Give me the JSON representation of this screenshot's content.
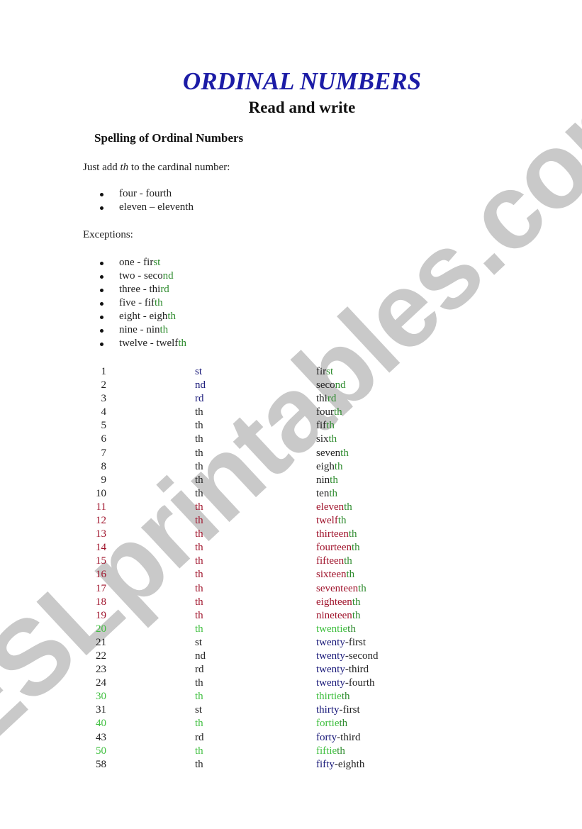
{
  "watermark": "ESLprintables.com",
  "header": {
    "title": "ORDINAL NUMBERS",
    "subtitle": "Read and write"
  },
  "section": {
    "heading": "Spelling of Ordinal Numbers",
    "intro_pre": "Just add ",
    "intro_em": "th",
    "intro_post": " to the cardinal number:",
    "rule_examples": [
      {
        "text": "four - fourth"
      },
      {
        "text": "eleven – eleventh"
      }
    ],
    "exceptions_label": "Exceptions:",
    "exceptions": [
      {
        "base": "one - fir",
        "ending": "st"
      },
      {
        "base": "two - seco",
        "ending": "nd"
      },
      {
        "base": "three - thi",
        "ending": "rd"
      },
      {
        "base": "five - fif",
        "ending": "th"
      },
      {
        "base": "eight - eigh",
        "ending": "th"
      },
      {
        "base": "nine - nin",
        "ending": "th"
      },
      {
        "base": "twelve - twelf",
        "ending": "th"
      }
    ]
  },
  "colors": {
    "title": "#1c1ca6",
    "navy": "#1a1a7a",
    "red": "#a0142c",
    "light_green": "#3fbf3f",
    "dark_green": "#2e8b2e",
    "dark": "#222222",
    "watermark": "#c9c9c9"
  },
  "table": {
    "rows": [
      {
        "num": "1",
        "suffix": "st",
        "stem": "fir",
        "ending": "st",
        "numColor": "dark",
        "sufColor": "navy",
        "stemColor": "dark",
        "endColor": "dgreen"
      },
      {
        "num": "2",
        "suffix": "nd",
        "stem": "seco",
        "ending": "nd",
        "numColor": "dark",
        "sufColor": "navy",
        "stemColor": "dark",
        "endColor": "dgreen"
      },
      {
        "num": "3",
        "suffix": "rd",
        "stem": "thi",
        "ending": "rd",
        "numColor": "dark",
        "sufColor": "navy",
        "stemColor": "dark",
        "endColor": "dgreen"
      },
      {
        "num": "4",
        "suffix": "th",
        "stem": "four",
        "ending": "th",
        "numColor": "dark",
        "sufColor": "dark",
        "stemColor": "dark",
        "endColor": "dgreen"
      },
      {
        "num": "5",
        "suffix": "th",
        "stem": "fif",
        "ending": "th",
        "numColor": "dark",
        "sufColor": "dark",
        "stemColor": "dark",
        "endColor": "dgreen"
      },
      {
        "num": "6",
        "suffix": "th",
        "stem": "six",
        "ending": "th",
        "numColor": "dark",
        "sufColor": "dark",
        "stemColor": "dark",
        "endColor": "dgreen"
      },
      {
        "num": "7",
        "suffix": "th",
        "stem": "seven",
        "ending": "th",
        "numColor": "dark",
        "sufColor": "dark",
        "stemColor": "dark",
        "endColor": "dgreen"
      },
      {
        "num": "8",
        "suffix": "th",
        "stem": "eigh",
        "ending": "th",
        "numColor": "dark",
        "sufColor": "dark",
        "stemColor": "dark",
        "endColor": "dgreen"
      },
      {
        "num": "9",
        "suffix": "th",
        "stem": "nin",
        "ending": "th",
        "numColor": "dark",
        "sufColor": "dark",
        "stemColor": "dark",
        "endColor": "dgreen"
      },
      {
        "num": "10",
        "suffix": "th",
        "stem": "ten",
        "ending": "th",
        "numColor": "dark",
        "sufColor": "dark",
        "stemColor": "dark",
        "endColor": "dgreen"
      },
      {
        "num": "11",
        "suffix": "th",
        "stem": "eleven",
        "ending": "th",
        "numColor": "red",
        "sufColor": "red",
        "stemColor": "red",
        "endColor": "dgreen"
      },
      {
        "num": "12",
        "suffix": "th",
        "stem": "twelf",
        "ending": "th",
        "numColor": "red",
        "sufColor": "red",
        "stemColor": "red",
        "endColor": "dgreen"
      },
      {
        "num": "13",
        "suffix": "th",
        "stem": "thirteen",
        "ending": "th",
        "numColor": "red",
        "sufColor": "red",
        "stemColor": "red",
        "endColor": "dgreen"
      },
      {
        "num": "14",
        "suffix": "th",
        "stem": "fourteen",
        "ending": "th",
        "numColor": "red",
        "sufColor": "red",
        "stemColor": "red",
        "endColor": "dgreen"
      },
      {
        "num": "15",
        "suffix": "th",
        "stem": "fifteen",
        "ending": "th",
        "numColor": "red",
        "sufColor": "red",
        "stemColor": "red",
        "endColor": "dgreen"
      },
      {
        "num": "16",
        "suffix": "th",
        "stem": "sixteen",
        "ending": "th",
        "numColor": "red",
        "sufColor": "red",
        "stemColor": "red",
        "endColor": "dgreen"
      },
      {
        "num": "17",
        "suffix": "th",
        "stem": "seventeen",
        "ending": "th",
        "numColor": "red",
        "sufColor": "red",
        "stemColor": "red",
        "endColor": "dgreen"
      },
      {
        "num": "18",
        "suffix": "th",
        "stem": "eighteen",
        "ending": "th",
        "numColor": "red",
        "sufColor": "red",
        "stemColor": "red",
        "endColor": "dgreen"
      },
      {
        "num": "19",
        "suffix": "th",
        "stem": "nineteen",
        "ending": "th",
        "numColor": "red",
        "sufColor": "red",
        "stemColor": "red",
        "endColor": "dgreen"
      },
      {
        "num": "20",
        "suffix": "th",
        "stem": "twentie",
        "ending": "th",
        "numColor": "lgreen",
        "sufColor": "lgreen",
        "stemColor": "lgreen",
        "endColor": "dgreen"
      },
      {
        "num": "21",
        "suffix": "st",
        "stem": "twenty",
        "ending": "-first",
        "numColor": "dark",
        "sufColor": "dark",
        "stemColor": "navy",
        "endColor": "dark"
      },
      {
        "num": "22",
        "suffix": "nd",
        "stem": "twenty",
        "ending": "-second",
        "numColor": "dark",
        "sufColor": "dark",
        "stemColor": "navy",
        "endColor": "dark"
      },
      {
        "num": "23",
        "suffix": "rd",
        "stem": "twenty",
        "ending": "-third",
        "numColor": "dark",
        "sufColor": "dark",
        "stemColor": "navy",
        "endColor": "dark"
      },
      {
        "num": "24",
        "suffix": "th",
        "stem": "twenty",
        "ending": "-fourth",
        "numColor": "dark",
        "sufColor": "dark",
        "stemColor": "navy",
        "endColor": "dark"
      },
      {
        "num": "30",
        "suffix": "th",
        "stem": "thirtie",
        "ending": "th",
        "numColor": "lgreen",
        "sufColor": "lgreen",
        "stemColor": "lgreen",
        "endColor": "dgreen"
      },
      {
        "num": "31",
        "suffix": "st",
        "stem": "thirty",
        "ending": "-first",
        "numColor": "dark",
        "sufColor": "dark",
        "stemColor": "navy",
        "endColor": "dark"
      },
      {
        "num": "40",
        "suffix": "th",
        "stem": "fortie",
        "ending": "th",
        "numColor": "lgreen",
        "sufColor": "lgreen",
        "stemColor": "lgreen",
        "endColor": "dgreen"
      },
      {
        "num": "43",
        "suffix": "rd",
        "stem": "forty",
        "ending": "-third",
        "numColor": "dark",
        "sufColor": "dark",
        "stemColor": "navy",
        "endColor": "dark"
      },
      {
        "num": "50",
        "suffix": "th",
        "stem": "fiftie",
        "ending": "th",
        "numColor": "lgreen",
        "sufColor": "lgreen",
        "stemColor": "lgreen",
        "endColor": "dgreen"
      },
      {
        "num": "58",
        "suffix": "th",
        "stem": "fifty",
        "ending": "-eighth",
        "numColor": "dark",
        "sufColor": "dark",
        "stemColor": "navy",
        "endColor": "dark"
      }
    ]
  }
}
